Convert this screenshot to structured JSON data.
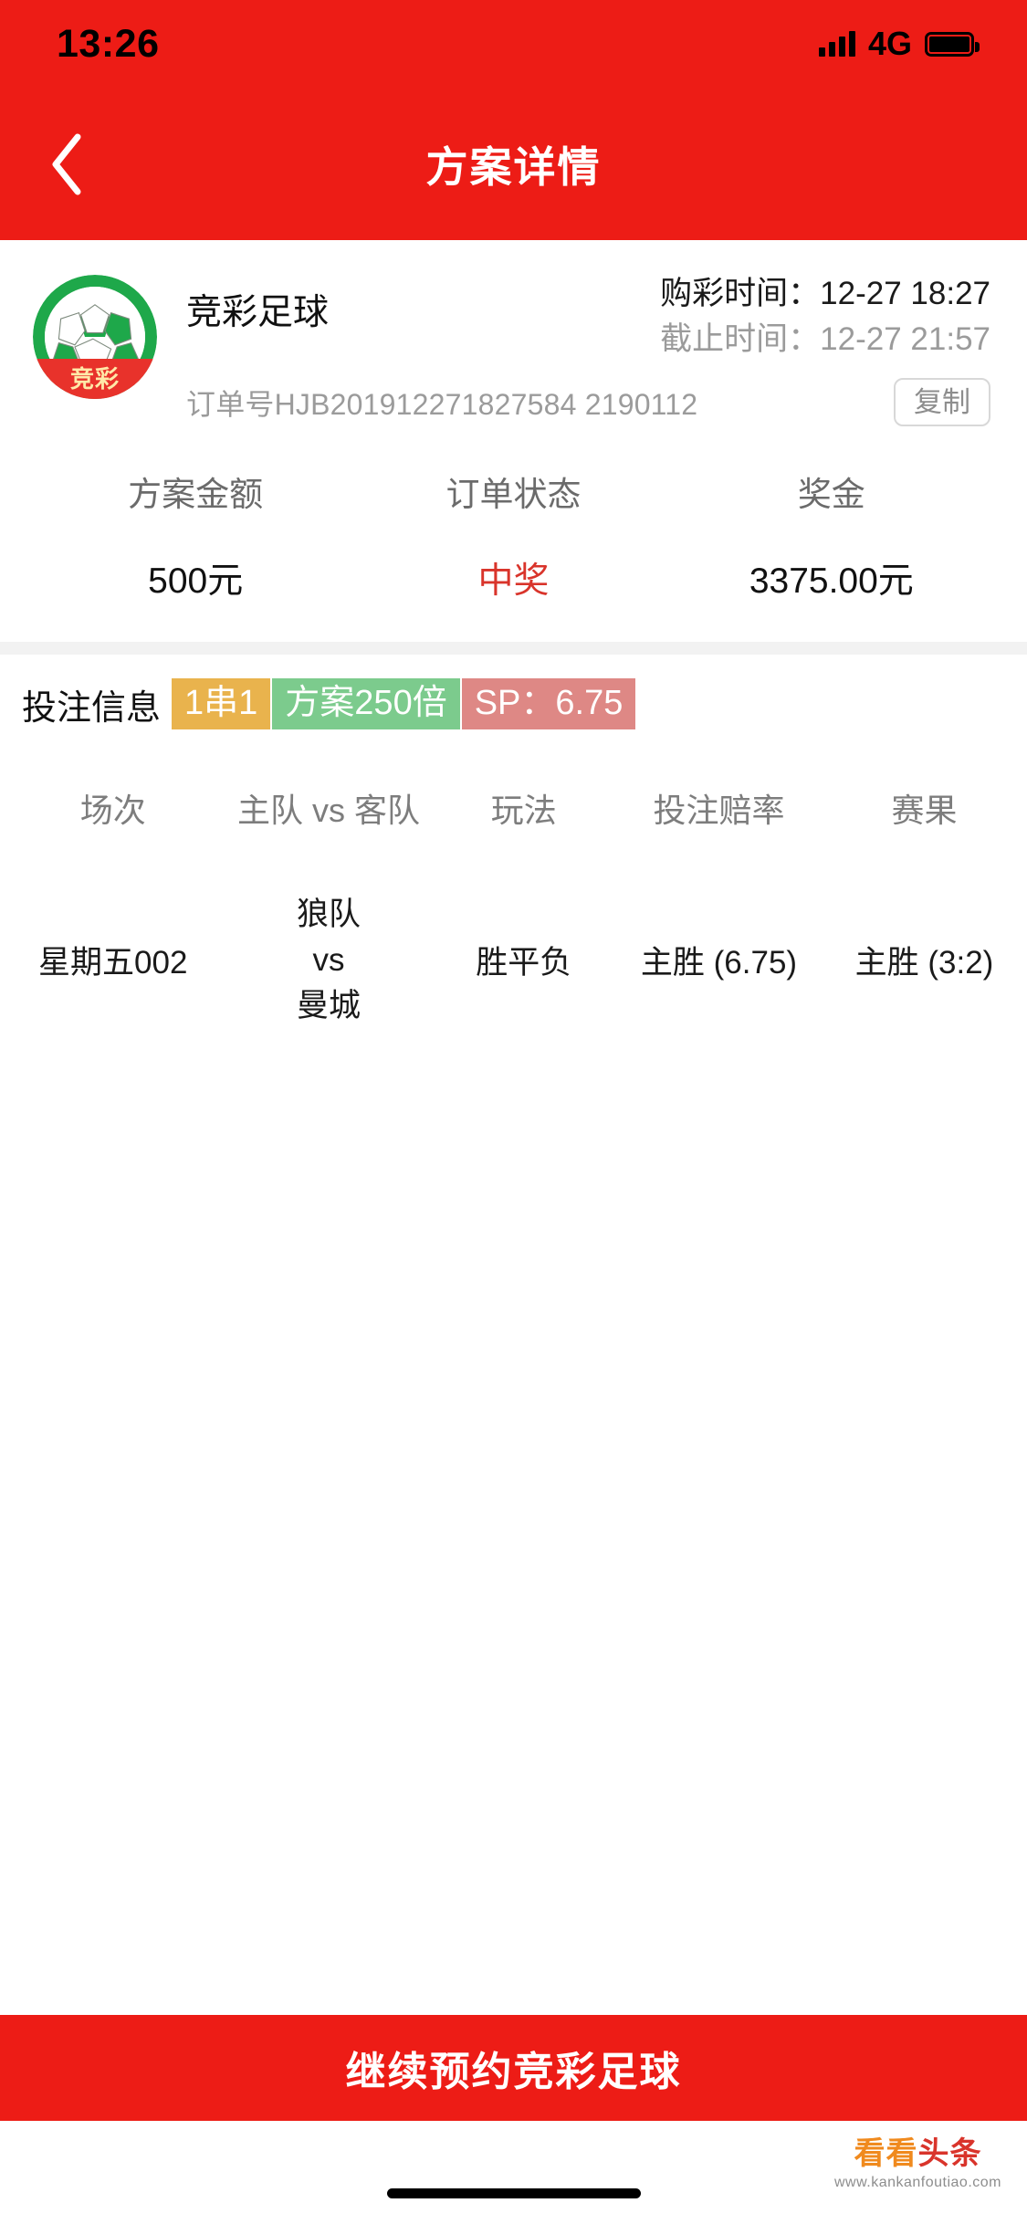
{
  "status_bar": {
    "time": "13:26",
    "network": "4G",
    "signal_icon": "signal-bars-icon",
    "battery_icon": "battery-full-icon"
  },
  "nav": {
    "back_icon": "chevron-left-icon",
    "title": "方案详情"
  },
  "order_card": {
    "logo_icon": "soccer-ball-icon",
    "logo_badge": "竞彩",
    "product_name": "竞彩足球",
    "purchase_time": "购彩时间：12-27 18:27",
    "deadline_time": "截止时间：12-27 21:57",
    "order_no": "订单号HJB201912271827584 2190112",
    "copy_label": "复制"
  },
  "stats": [
    {
      "label": "方案金额",
      "value": "500元",
      "highlight": false
    },
    {
      "label": "订单状态",
      "value": "中奖",
      "highlight": true
    },
    {
      "label": "奖金",
      "value": "3375.00元",
      "highlight": false
    }
  ],
  "bet_info": {
    "title": "投注信息",
    "tags": [
      {
        "text": "1串1",
        "color": "#E9B34D"
      },
      {
        "text": "方案250倍",
        "color": "#7CCB8D"
      },
      {
        "text": "SP：6.75",
        "color": "#DE8885"
      }
    ]
  },
  "bets_table": {
    "headers": [
      "场次",
      "主队 vs 客队",
      "玩法",
      "投注赔率",
      "赛果"
    ],
    "rows": [
      {
        "match_no": "星期五002",
        "home": "狼队",
        "vs": "vs",
        "away": "曼城",
        "play_type": "胜平负",
        "odds": "主胜 (6.75)",
        "result": "主胜 (3:2)"
      }
    ]
  },
  "cta": {
    "label": "继续预约竞彩足球"
  },
  "watermark": {
    "main_left": "看看",
    "main_right": "头条",
    "sub": "www.kankanfoutiao.com"
  },
  "colors": {
    "brand_red": "#ED1C16",
    "accent_red": "#D9342B",
    "logo_green": "#1EA84A"
  }
}
